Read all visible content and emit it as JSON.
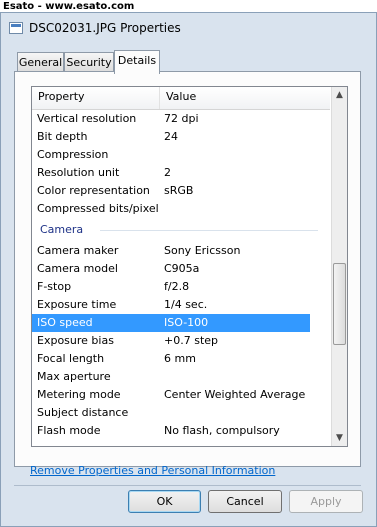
{
  "watermark": "Esato - www.esato.com",
  "window": {
    "title": "DSC02031.JPG Properties"
  },
  "tabs": [
    {
      "label": "General",
      "active": false
    },
    {
      "label": "Security",
      "active": false
    },
    {
      "label": "Details",
      "active": true
    }
  ],
  "list": {
    "col_property": "Property",
    "col_value": "Value",
    "image_rows": [
      {
        "property": "Vertical resolution",
        "value": "72 dpi"
      },
      {
        "property": "Bit depth",
        "value": "24"
      },
      {
        "property": "Compression",
        "value": ""
      },
      {
        "property": "Resolution unit",
        "value": "2"
      },
      {
        "property": "Color representation",
        "value": "sRGB"
      },
      {
        "property": "Compressed bits/pixel",
        "value": ""
      }
    ],
    "group_label": "Camera",
    "camera_rows": [
      {
        "property": "Camera maker",
        "value": "Sony Ericsson"
      },
      {
        "property": "Camera model",
        "value": "C905a"
      },
      {
        "property": "F-stop",
        "value": "f/2.8"
      },
      {
        "property": "Exposure time",
        "value": "1/4 sec."
      },
      {
        "property": "ISO speed",
        "value": "ISO-100",
        "selected": true
      },
      {
        "property": "Exposure bias",
        "value": "+0.7 step"
      },
      {
        "property": "Focal length",
        "value": "6 mm"
      },
      {
        "property": "Max aperture",
        "value": ""
      },
      {
        "property": "Metering mode",
        "value": "Center Weighted Average"
      },
      {
        "property": "Subject distance",
        "value": ""
      },
      {
        "property": "Flash mode",
        "value": "No flash, compulsory"
      }
    ]
  },
  "remove_link": "Remove Properties and Personal Information",
  "buttons": {
    "ok": "OK",
    "cancel": "Cancel",
    "apply": "Apply"
  }
}
